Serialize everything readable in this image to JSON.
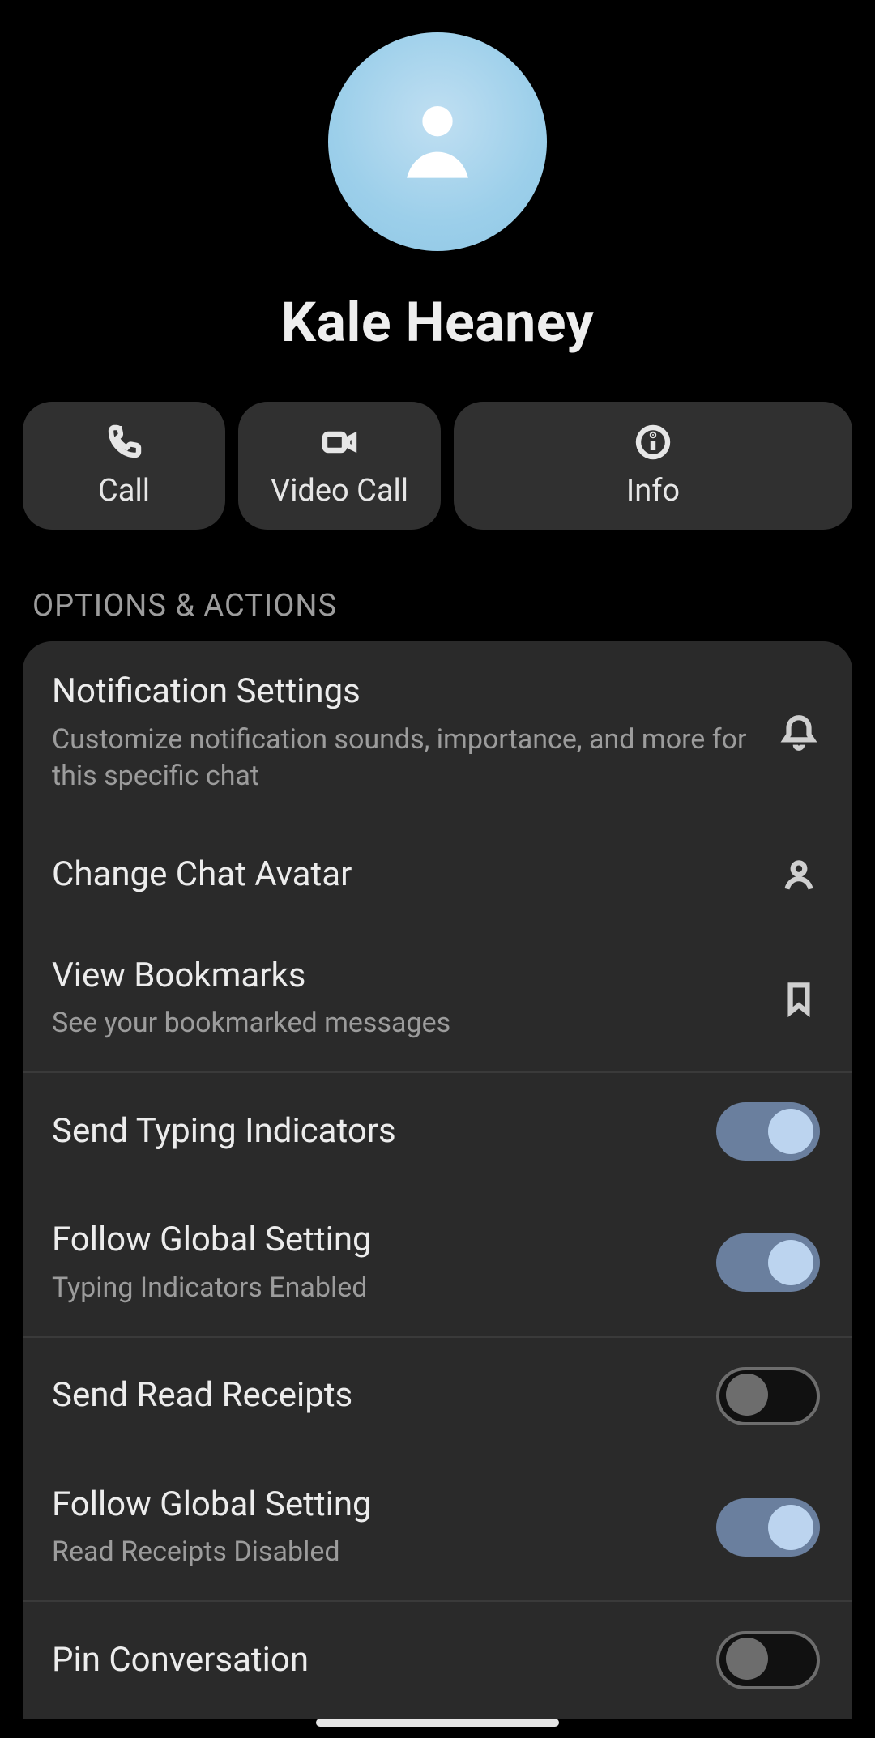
{
  "contact": {
    "name": "Kale Heaney"
  },
  "actions": {
    "call": "Call",
    "video": "Video Call",
    "info": "Info"
  },
  "section_title": "OPTIONS & ACTIONS",
  "options": {
    "notification": {
      "title": "Notification Settings",
      "subtitle": "Customize notification sounds, importance, and more for this specific chat"
    },
    "change_avatar": {
      "title": "Change Chat Avatar"
    },
    "bookmarks": {
      "title": "View Bookmarks",
      "subtitle": "See your bookmarked messages"
    },
    "typing_indicators": {
      "title": "Send Typing Indicators",
      "enabled": true
    },
    "typing_follow_global": {
      "title": "Follow Global Setting",
      "subtitle": "Typing Indicators Enabled",
      "enabled": true
    },
    "read_receipts": {
      "title": "Send Read Receipts",
      "enabled": false
    },
    "read_follow_global": {
      "title": "Follow Global Setting",
      "subtitle": "Read Receipts Disabled",
      "enabled": true
    },
    "pin": {
      "title": "Pin Conversation",
      "enabled": false
    }
  }
}
